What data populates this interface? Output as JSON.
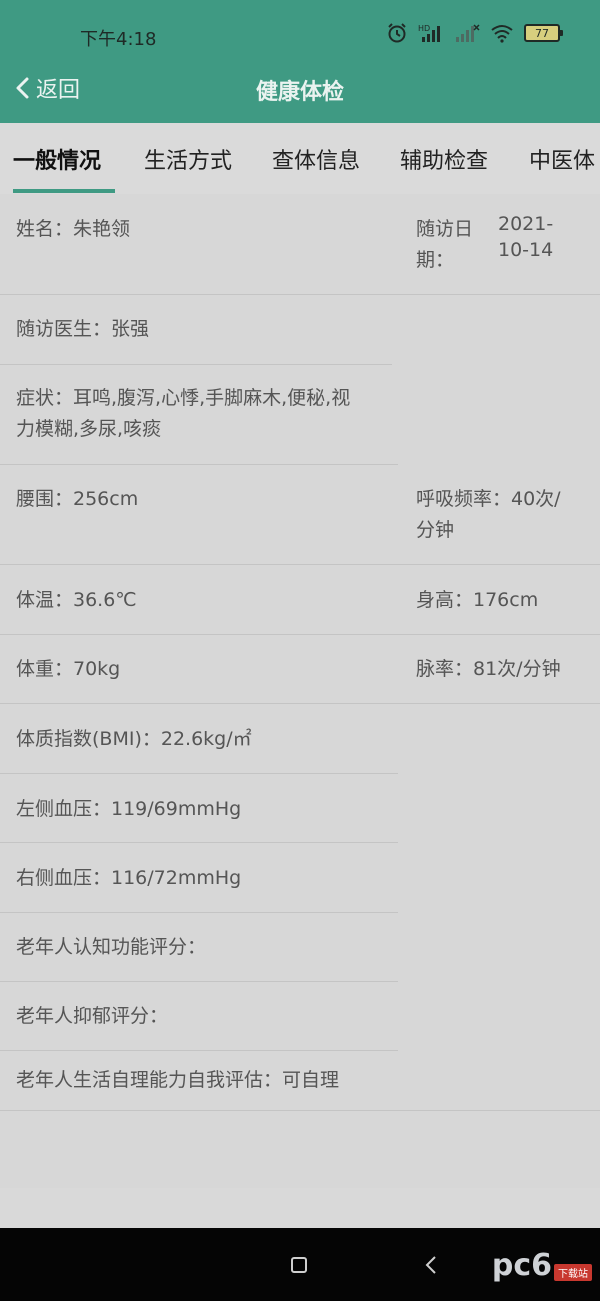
{
  "status_bar": {
    "time": "下午4:18",
    "battery_level": "77",
    "icons": [
      "alarm-icon",
      "hd-signal-icon",
      "signal-bars-icon",
      "no-signal-icon",
      "wifi-icon",
      "battery-icon"
    ]
  },
  "navbar": {
    "back_label": "返回",
    "title": "健康体检"
  },
  "tabs": [
    {
      "label": "一般情况",
      "active": true
    },
    {
      "label": "生活方式",
      "active": false
    },
    {
      "label": "查体信息",
      "active": false
    },
    {
      "label": "辅助检查",
      "active": false
    },
    {
      "label": "中医体",
      "active": false
    }
  ],
  "fields": {
    "name": "姓名：朱艳领",
    "visit_date_label_1": "随访日",
    "visit_date_label_2": "期：",
    "visit_date_value_1": "2021-",
    "visit_date_value_2": "10-14",
    "doctor": "随访医生：张强",
    "symptoms_1": "症状：耳鸣,腹泻,心悸,手脚麻木,便秘,视",
    "symptoms_2": "力模糊,多尿,咳痰",
    "waist": "腰围：256cm",
    "respiration_1": "呼吸频率：40次/",
    "respiration_2": "分钟",
    "temperature": "体温：36.6℃",
    "height": "身高：176cm",
    "weight": "体重：70kg",
    "pulse": "脉率：81次/分钟",
    "bmi": "体质指数(BMI)：22.6kg/㎡",
    "bp_left": "左侧血压：119/69mmHg",
    "bp_right": "右侧血压：116/72mmHg",
    "cognitive": "老年人认知功能评分：",
    "depression": "老年人抑郁评分：",
    "self_care": "老年人生活自理能力自我评估：可自理"
  },
  "watermark": {
    "text": "pc6",
    "badge": "下载站"
  },
  "colors": {
    "header": "#3f9a83",
    "background": "#d7d7d7",
    "nav_bar": "#050505"
  }
}
